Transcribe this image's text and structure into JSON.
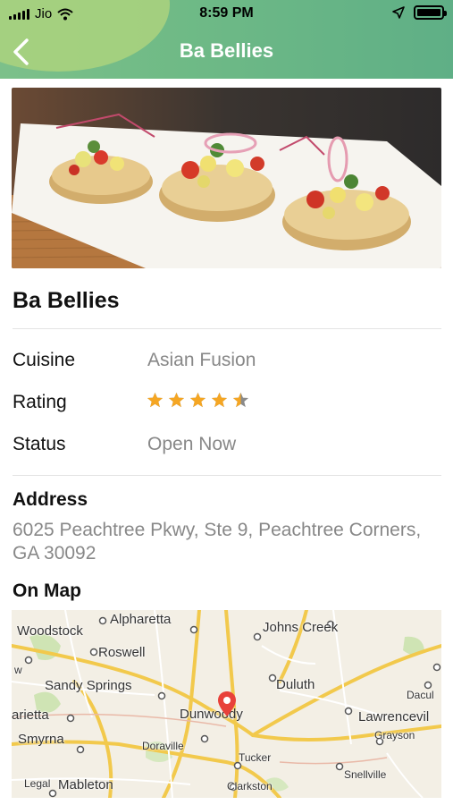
{
  "status_bar": {
    "carrier": "Jio",
    "time": "8:59 PM"
  },
  "nav": {
    "title": "Ba Bellies",
    "back_icon": "chevron-left-icon"
  },
  "restaurant": {
    "name": "Ba Bellies",
    "details": [
      {
        "label": "Cuisine",
        "value": "Asian Fusion"
      },
      {
        "label": "Rating",
        "value": null
      },
      {
        "label": "Status",
        "value": "Open Now"
      }
    ],
    "rating": 4.5,
    "rating_max": 5,
    "address_heading": "Address",
    "address": "6025 Peachtree Pkwy, Ste 9, Peachtree Corners, GA 30092",
    "map_heading": "On Map"
  },
  "map": {
    "labels": [
      "Alpharetta",
      "Woodstock",
      "Johns Creek",
      "Roswell",
      "Sandy Springs",
      "Duluth",
      "Dacul",
      "arietta",
      "Dunwoody",
      "Lawrencevil",
      "Grayson",
      "Smyrna",
      "Doraville",
      "Tucker",
      "Snellville",
      "Legal",
      "Mableton",
      "Clarkston",
      "w"
    ]
  },
  "colors": {
    "header_start": "#7cc08a",
    "header_end": "#5faf86",
    "star": "#f5a623",
    "pin": "#e8413a"
  }
}
